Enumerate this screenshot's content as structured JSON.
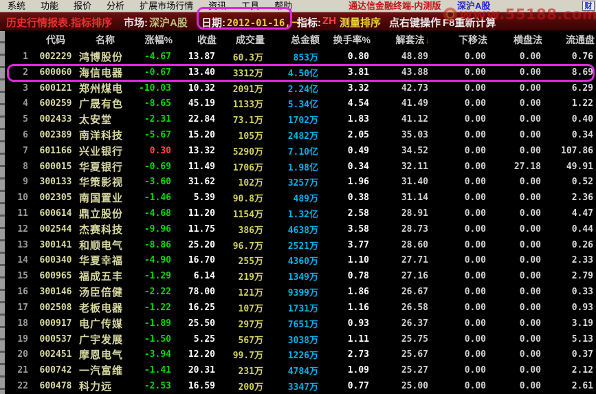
{
  "menubar": {
    "items": [
      "系统",
      "功能",
      "报价",
      "分析",
      "扩展市场行情",
      "资讯",
      "工具",
      "帮助"
    ],
    "app_title": "通达信金融终端-内测版",
    "market": "深沪A股",
    "corner_icon": "财"
  },
  "statusbar": {
    "report_title": "历史行情报表.指标排序",
    "market_label": "市场:",
    "market_value": "深沪A股",
    "date_label": "日期:",
    "date_value": "2012-01-16,一",
    "indicator_label": "指标:",
    "indicator_prefix": "ZH",
    "indicator_name": "测量排序",
    "hint_action": "点右键操作",
    "hint_recalc": "F8重新计算"
  },
  "watermark": {
    "text": "www.55188.com"
  },
  "colors": {
    "highlight_annotation": "#dc28dc",
    "negative": "#00dc00",
    "positive": "#ff4242",
    "amount_cyan": "#00b2e8",
    "code_yellow": "#d8d8a0"
  },
  "table": {
    "sort_arrow": "↓",
    "columns": [
      {
        "key": "num",
        "label": ""
      },
      {
        "key": "code",
        "label": "代码"
      },
      {
        "key": "name",
        "label": "名称"
      },
      {
        "key": "change",
        "label": "涨幅%"
      },
      {
        "key": "close",
        "label": "收盘"
      },
      {
        "key": "volume",
        "label": "成交量"
      },
      {
        "key": "amount",
        "label": "总金额"
      },
      {
        "key": "turnover",
        "label": "换手率%"
      },
      {
        "key": "jtf",
        "label": "解套法",
        "sorted": true
      },
      {
        "key": "xyf",
        "label": "下移法"
      },
      {
        "key": "hpf",
        "label": "横盘法"
      },
      {
        "key": "ltp",
        "label": "流通盘"
      }
    ],
    "rows": [
      {
        "num": "1",
        "code": "002229",
        "name": "鸿博股份",
        "change": "-4.67",
        "close": "13.87",
        "volume": "60.3万",
        "amount": "853万",
        "turnover": "0.80",
        "jtf": "48.89",
        "xyf": "0.00",
        "hpf": "0.00",
        "ltp": "0.76",
        "highlighted": false
      },
      {
        "num": "2",
        "code": "600060",
        "name": "海信电器",
        "change": "-0.67",
        "close": "13.40",
        "volume": "3312万",
        "amount": "4.50亿",
        "turnover": "3.81",
        "jtf": "43.88",
        "xyf": "0.00",
        "hpf": "0.00",
        "ltp": "8.69",
        "highlighted": true
      },
      {
        "num": "3",
        "code": "600121",
        "name": "郑州煤电",
        "change": "-10.03",
        "close": "10.32",
        "volume": "2091万",
        "amount": "2.24亿",
        "turnover": "3.32",
        "jtf": "42.73",
        "xyf": "0.00",
        "hpf": "0.00",
        "ltp": "6.29",
        "highlighted": false
      },
      {
        "num": "4",
        "code": "600259",
        "name": "广晟有色",
        "change": "-8.65",
        "close": "45.19",
        "volume": "1133万",
        "amount": "5.34亿",
        "turnover": "4.54",
        "jtf": "41.49",
        "xyf": "0.00",
        "hpf": "0.00",
        "ltp": "1.22",
        "highlighted": false
      },
      {
        "num": "5",
        "code": "002433",
        "name": "太安堂",
        "change": "-2.31",
        "close": "22.84",
        "volume": "73.1万",
        "amount": "1702万",
        "turnover": "1.83",
        "jtf": "41.12",
        "xyf": "0.00",
        "hpf": "0.00",
        "ltp": "0.40",
        "highlighted": false
      },
      {
        "num": "6",
        "code": "002389",
        "name": "南洋科技",
        "change": "-5.67",
        "close": "15.20",
        "volume": "105万",
        "amount": "2482万",
        "turnover": "2.05",
        "jtf": "35.03",
        "xyf": "0.00",
        "hpf": "0.00",
        "ltp": "0.34",
        "highlighted": false
      },
      {
        "num": "7",
        "code": "601166",
        "name": "兴业银行",
        "change": "0.30",
        "close": "13.32",
        "volume": "5290万",
        "amount": "7.10亿",
        "turnover": "0.49",
        "jtf": "34.52",
        "xyf": "0.00",
        "hpf": "0.00",
        "ltp": "107.86",
        "highlighted": false
      },
      {
        "num": "8",
        "code": "600015",
        "name": "华夏银行",
        "change": "-0.69",
        "close": "11.49",
        "volume": "1706万",
        "amount": "1.98亿",
        "turnover": "0.34",
        "jtf": "32.11",
        "xyf": "0.00",
        "hpf": "27.18",
        "ltp": "49.91",
        "highlighted": false
      },
      {
        "num": "9",
        "code": "300133",
        "name": "华策影视",
        "change": "-3.60",
        "close": "31.62",
        "volume": "102万",
        "amount": "3257万",
        "turnover": "1.96",
        "jtf": "31.40",
        "xyf": "0.00",
        "hpf": "0.00",
        "ltp": "0.52",
        "highlighted": false
      },
      {
        "num": "10",
        "code": "002305",
        "name": "南国置业",
        "change": "-1.46",
        "close": "5.39",
        "volume": "90.8万",
        "amount": "489万",
        "turnover": "0.38",
        "jtf": "31.14",
        "xyf": "0.00",
        "hpf": "0.00",
        "ltp": "2.36",
        "highlighted": false
      },
      {
        "num": "11",
        "code": "600614",
        "name": "鼎立股份",
        "change": "-4.68",
        "close": "11.20",
        "volume": "1154万",
        "amount": "1.32亿",
        "turnover": "2.58",
        "jtf": "28.91",
        "xyf": "0.00",
        "hpf": "0.00",
        "ltp": "4.47",
        "highlighted": false
      },
      {
        "num": "12",
        "code": "002544",
        "name": "杰赛科技",
        "change": "-9.96",
        "close": "11.75",
        "volume": "386万",
        "amount": "4638万",
        "turnover": "3.58",
        "jtf": "28.73",
        "xyf": "0.00",
        "hpf": "0.00",
        "ltp": "0.44",
        "highlighted": false
      },
      {
        "num": "13",
        "code": "300141",
        "name": "和顺电气",
        "change": "-8.86",
        "close": "25.20",
        "volume": "96.7万",
        "amount": "2521万",
        "turnover": "3.77",
        "jtf": "28.60",
        "xyf": "0.00",
        "hpf": "0.00",
        "ltp": "0.26",
        "highlighted": false
      },
      {
        "num": "14",
        "code": "600340",
        "name": "华夏幸福",
        "change": "-4.90",
        "close": "16.70",
        "volume": "255万",
        "amount": "4360万",
        "turnover": "1.10",
        "jtf": "27.71",
        "xyf": "0.00",
        "hpf": "0.00",
        "ltp": "2.33",
        "highlighted": false
      },
      {
        "num": "15",
        "code": "600965",
        "name": "福成五丰",
        "change": "-1.29",
        "close": "6.14",
        "volume": "219万",
        "amount": "1349万",
        "turnover": "0.78",
        "jtf": "27.16",
        "xyf": "0.00",
        "hpf": "0.00",
        "ltp": "2.79",
        "highlighted": false
      },
      {
        "num": "16",
        "code": "300146",
        "name": "汤臣倍健",
        "change": "-2.22",
        "close": "78.00",
        "volume": "121万",
        "amount": "9399万",
        "turnover": "1.86",
        "jtf": "26.67",
        "xyf": "0.00",
        "hpf": "0.00",
        "ltp": "0.33",
        "highlighted": false
      },
      {
        "num": "17",
        "code": "002508",
        "name": "老板电器",
        "change": "-1.22",
        "close": "16.25",
        "volume": "107万",
        "amount": "1731万",
        "turnover": "1.16",
        "jtf": "26.58",
        "xyf": "0.00",
        "hpf": "0.00",
        "ltp": "0.93",
        "highlighted": false
      },
      {
        "num": "18",
        "code": "000917",
        "name": "电广传媒",
        "change": "-1.89",
        "close": "25.50",
        "volume": "297万",
        "amount": "7651万",
        "turnover": "0.93",
        "jtf": "26.37",
        "xyf": "0.00",
        "hpf": "0.00",
        "ltp": "3.19",
        "highlighted": false
      },
      {
        "num": "19",
        "code": "000537",
        "name": "广宇发展",
        "change": "-1.50",
        "close": "5.25",
        "volume": "567万",
        "amount": "3038万",
        "turnover": "1.11",
        "jtf": "25.75",
        "xyf": "0.00",
        "hpf": "0.00",
        "ltp": "5.13",
        "highlighted": false
      },
      {
        "num": "20",
        "code": "002451",
        "name": "摩恩电气",
        "change": "-3.94",
        "close": "12.20",
        "volume": "99.7万",
        "amount": "1226万",
        "turnover": "2.73",
        "jtf": "25.67",
        "xyf": "0.00",
        "hpf": "0.00",
        "ltp": "0.37",
        "highlighted": false
      },
      {
        "num": "21",
        "code": "600742",
        "name": "一汽富维",
        "change": "-1.41",
        "close": "20.31",
        "volume": "231万",
        "amount": "4784万",
        "turnover": "1.09",
        "jtf": "25.27",
        "xyf": "0.00",
        "hpf": "0.00",
        "ltp": "2.12",
        "highlighted": false
      },
      {
        "num": "22",
        "code": "600478",
        "name": "科力远",
        "change": "-2.53",
        "close": "16.59",
        "volume": "200万",
        "amount": "3347万",
        "turnover": "0.77",
        "jtf": "25.00",
        "xyf": "0.00",
        "hpf": "0.00",
        "ltp": "2.61",
        "highlighted": false
      }
    ]
  }
}
